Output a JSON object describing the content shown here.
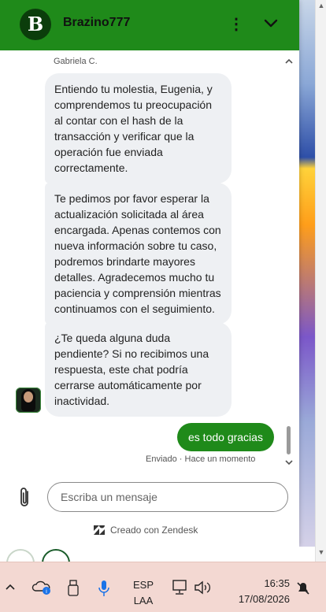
{
  "colors": {
    "brand_green": "#1f8a1a",
    "bubble_bg": "#eef0f3",
    "taskbar_bg": "#f3d8d2"
  },
  "header": {
    "logo_letter": "B",
    "brand": "Brazino777",
    "more_icon": "more-vertical-icon",
    "collapse_icon": "chevron-down-icon"
  },
  "chat": {
    "agent_name": "Gabriela C.",
    "messages": [
      "Entiendo tu molestia, Eugenia, y comprendemos tu preocupación al contar con el hash de la transacción y verificar que la operación fue enviada correctamente.",
      "Te pedimos por favor esperar la actualización solicitada al área encargada. Apenas contemos con nueva información sobre tu caso, podremos brindarte mayores detalles. Agradecemos mucho tu paciencia y comprensión mientras continuamos con el seguimiento.",
      "¿Te queda alguna duda pendiente? Si no recibimos una respuesta, este chat podría cerrarse automáticamente por inactividad."
    ],
    "user_message": "es todo gracias",
    "status": "Enviado · Hace un momento"
  },
  "composer": {
    "placeholder": "Escriba un mensaje",
    "attach_icon": "paperclip-icon"
  },
  "footer": {
    "powered_by": "Creado con Zendesk"
  },
  "taskbar": {
    "lang_line1": "ESP",
    "lang_line2": "LAA",
    "time": "16:35",
    "date": "17/08/2026",
    "icons": [
      "chevron-up-icon",
      "onedrive-icon",
      "usb-drive-icon",
      "microphone-icon",
      "network-icon",
      "volume-icon",
      "notifications-off-icon"
    ]
  }
}
